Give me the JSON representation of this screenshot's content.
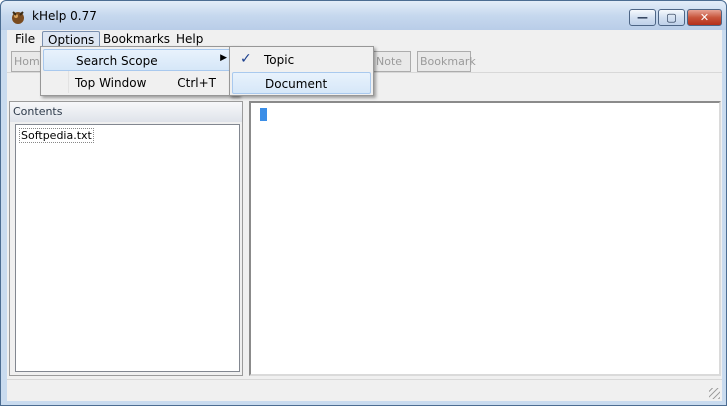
{
  "window": {
    "title": "kHelp 0.77",
    "buttons": {
      "minimize": "—",
      "maximize": "▢",
      "close": "✕"
    }
  },
  "menubar": {
    "items": [
      "File",
      "Options",
      "Bookmarks",
      "Help"
    ]
  },
  "toolbar": {
    "buttons": [
      "Home",
      "Note",
      "Bookmark"
    ]
  },
  "options_menu": {
    "items": [
      {
        "label": "Search Scope",
        "accelerator": "",
        "submenu_arrow": "▶"
      },
      {
        "label": "Top Window",
        "accelerator": "Ctrl+T",
        "submenu_arrow": ""
      }
    ]
  },
  "scope_menu": {
    "items": [
      {
        "label": "Topic",
        "check": "✓"
      },
      {
        "label": "Document",
        "check": ""
      }
    ]
  },
  "contents": {
    "header": "Contents",
    "items": [
      "Softpedia.txt"
    ]
  }
}
